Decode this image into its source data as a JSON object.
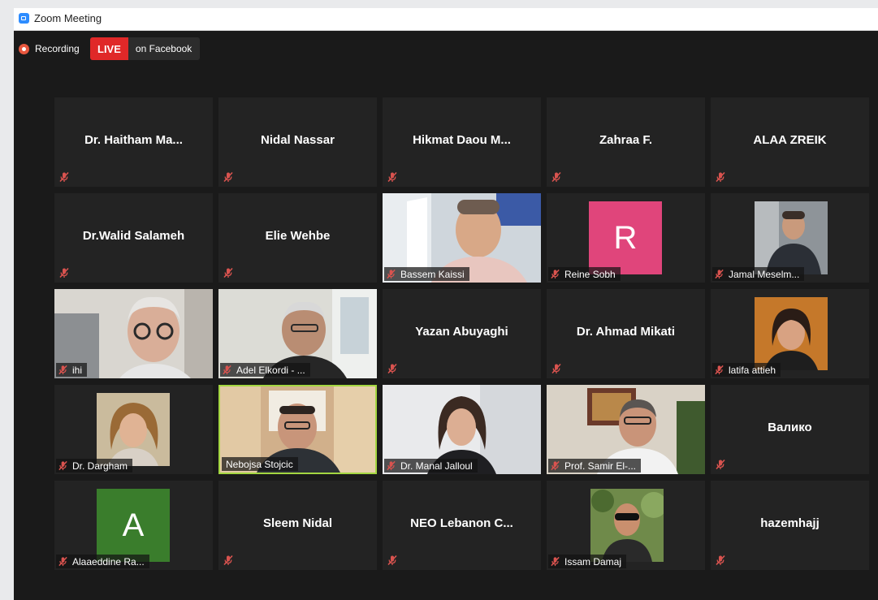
{
  "window": {
    "title": "Zoom Meeting"
  },
  "status": {
    "recording_label": "Recording",
    "live_label": "LIVE",
    "live_destination": "on Facebook"
  },
  "colors": {
    "live_red": "#e02828",
    "active_speaker": "#a4d641",
    "mute_red": "#d9534f"
  },
  "participants": [
    {
      "name": "Dr. Haitham Ma...",
      "muted": true,
      "display": "name"
    },
    {
      "name": "Nidal Nassar",
      "muted": true,
      "display": "name"
    },
    {
      "name": "Hikmat Daou M...",
      "muted": true,
      "display": "name"
    },
    {
      "name": "Zahraa F.",
      "muted": true,
      "display": "name"
    },
    {
      "name": "ALAA ZREIK",
      "muted": true,
      "display": "name"
    },
    {
      "name": "Dr.Walid Salameh",
      "muted": true,
      "display": "name"
    },
    {
      "name": "Elie Wehbe",
      "muted": true,
      "display": "name"
    },
    {
      "name": "Bassem Kaissi",
      "muted": true,
      "display": "video"
    },
    {
      "name": "Reine Sobh",
      "muted": true,
      "display": "avatar",
      "avatar_letter": "R",
      "avatar_color": "#e0457b"
    },
    {
      "name": "Jamal Meselm...",
      "muted": true,
      "display": "video"
    },
    {
      "name": "ihi",
      "muted": true,
      "display": "video"
    },
    {
      "name": "Adel Elkordi - ...",
      "muted": true,
      "display": "video"
    },
    {
      "name": "Yazan Abuyaghi",
      "muted": true,
      "display": "name"
    },
    {
      "name": "Dr. Ahmad Mikati",
      "muted": true,
      "display": "name"
    },
    {
      "name": "latifa attieh",
      "muted": true,
      "display": "video"
    },
    {
      "name": "Dr. Dargham",
      "muted": true,
      "display": "video"
    },
    {
      "name": "Nebojsa Stojcic",
      "muted": false,
      "display": "video",
      "active": true
    },
    {
      "name": "Dr. Manal Jalloul",
      "muted": true,
      "display": "video"
    },
    {
      "name": "Prof. Samir El-...",
      "muted": true,
      "display": "video"
    },
    {
      "name": "Валико",
      "muted": true,
      "display": "name"
    },
    {
      "name": "Alaaeddine Ra...",
      "muted": true,
      "display": "avatar",
      "avatar_letter": "A",
      "avatar_color": "#3a7d2c"
    },
    {
      "name": "Sleem Nidal",
      "muted": true,
      "display": "name"
    },
    {
      "name": "NEO Lebanon C...",
      "muted": true,
      "display": "name"
    },
    {
      "name": "Issam Damaj",
      "muted": true,
      "display": "video"
    },
    {
      "name": "hazemhajj",
      "muted": true,
      "display": "name"
    }
  ]
}
